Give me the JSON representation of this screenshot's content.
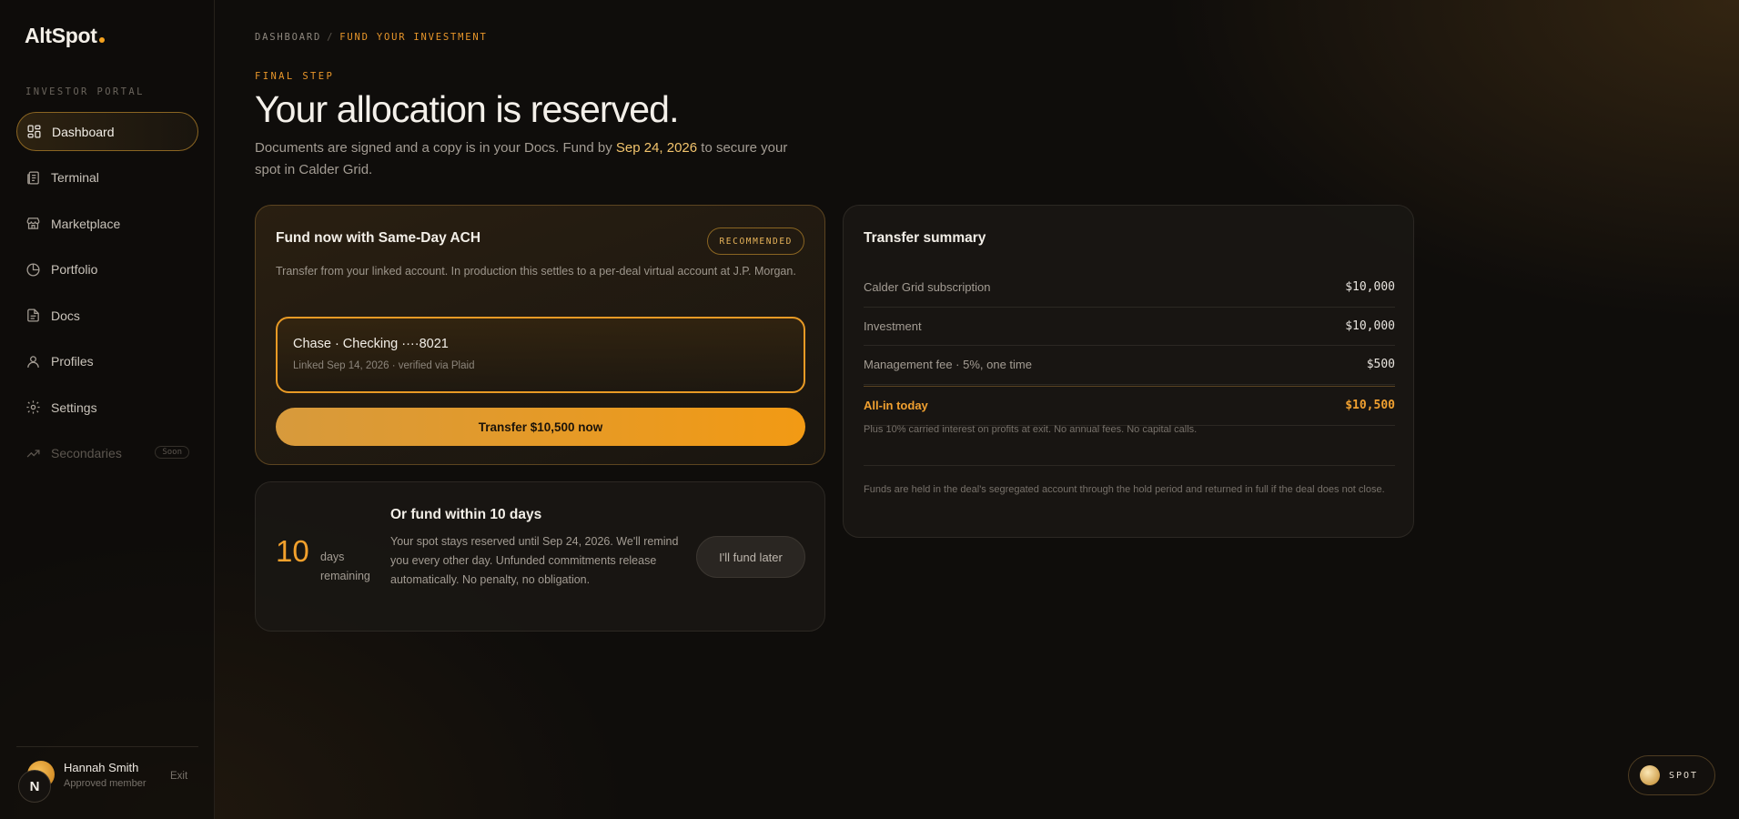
{
  "brand": {
    "name": "AltSpot"
  },
  "sidebar": {
    "section_label": "INVESTOR PORTAL",
    "items": [
      {
        "label": "Dashboard",
        "icon": "dashboard-icon",
        "state": "active"
      },
      {
        "label": "Terminal",
        "icon": "terminal-icon",
        "state": "default"
      },
      {
        "label": "Marketplace",
        "icon": "storefront-icon",
        "state": "default"
      },
      {
        "label": "Portfolio",
        "icon": "pie-chart-icon",
        "state": "default"
      },
      {
        "label": "Docs",
        "icon": "document-icon",
        "state": "default"
      },
      {
        "label": "Profiles",
        "icon": "user-icon",
        "state": "default"
      },
      {
        "label": "Settings",
        "icon": "gear-icon",
        "state": "default"
      },
      {
        "label": "Secondaries",
        "icon": "trending-up-icon",
        "state": "disabled",
        "badge": "Soon"
      }
    ],
    "user": {
      "initial": "N",
      "name": "Hannah Smith",
      "role": "Approved member",
      "exit_label": "Exit"
    }
  },
  "breadcrumb": {
    "root": "DASHBOARD",
    "separator": "/",
    "current": "FUND YOUR INVESTMENT"
  },
  "header": {
    "eyebrow": "FINAL STEP",
    "title": "Your allocation is reserved.",
    "subtitle_prefix": "Documents are signed and a copy is in your Docs. Fund by ",
    "subtitle_date": "Sep 24, 2026",
    "subtitle_suffix": " to secure your spot in Calder Grid."
  },
  "ach_card": {
    "title": "Fund now with Same-Day ACH",
    "badge": "RECOMMENDED",
    "description": "Transfer from your linked account. In production this settles to a per-deal virtual account at J.P. Morgan.",
    "account_name": "Chase · Checking ····8021",
    "account_meta": "Linked Sep 14, 2026 · verified via Plaid",
    "button_label": "Transfer $10,500 now"
  },
  "later_card": {
    "days_number": "10",
    "days_label": "days remaining",
    "title": "Or fund within 10 days",
    "description": "Your spot stays reserved until Sep 24, 2026. We'll remind you every other day. Unfunded commitments release automatically. No penalty, no obligation.",
    "button_label": "I'll fund later"
  },
  "summary": {
    "title": "Transfer summary",
    "rows": [
      {
        "label": "Calder Grid subscription",
        "value": "$10,000"
      },
      {
        "label": "Investment",
        "value": "$10,000"
      },
      {
        "label": "Management fee · 5%, one time",
        "value": "$500"
      }
    ],
    "total": {
      "label": "All-in today",
      "value": "$10,500"
    },
    "note": "Plus 10% carried interest on profits at exit. No annual fees. No capital calls.",
    "footer": "Funds are held in the deal's segregated account through the hold period and returned in full if the deal does not close."
  },
  "spot_widget": {
    "label": "SPOT"
  },
  "colors": {
    "accent": "#f29a14",
    "accent_text": "#e8962a",
    "date_highlight": "#f2c46d",
    "background": "#0f0d0b"
  }
}
